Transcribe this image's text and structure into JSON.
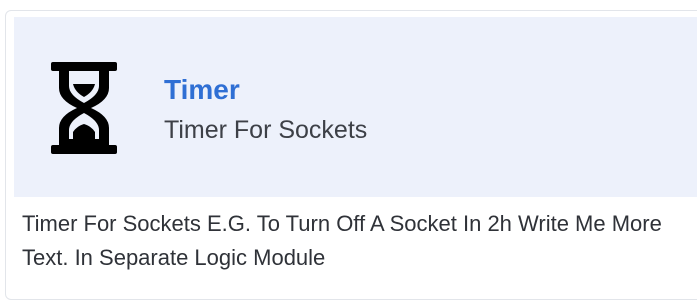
{
  "card": {
    "icon": "hourglass-icon",
    "title": "Timer",
    "subtitle": "Timer For Sockets",
    "description": "Timer For Sockets E.G. To Turn Off A Socket In 2h Write Me More Text. In Separate Logic Module"
  },
  "colors": {
    "header_background": "#edf1fb",
    "title": "#2f6fd4",
    "subtitle": "#3d4047",
    "description": "#2f3238",
    "icon": "#000000"
  }
}
